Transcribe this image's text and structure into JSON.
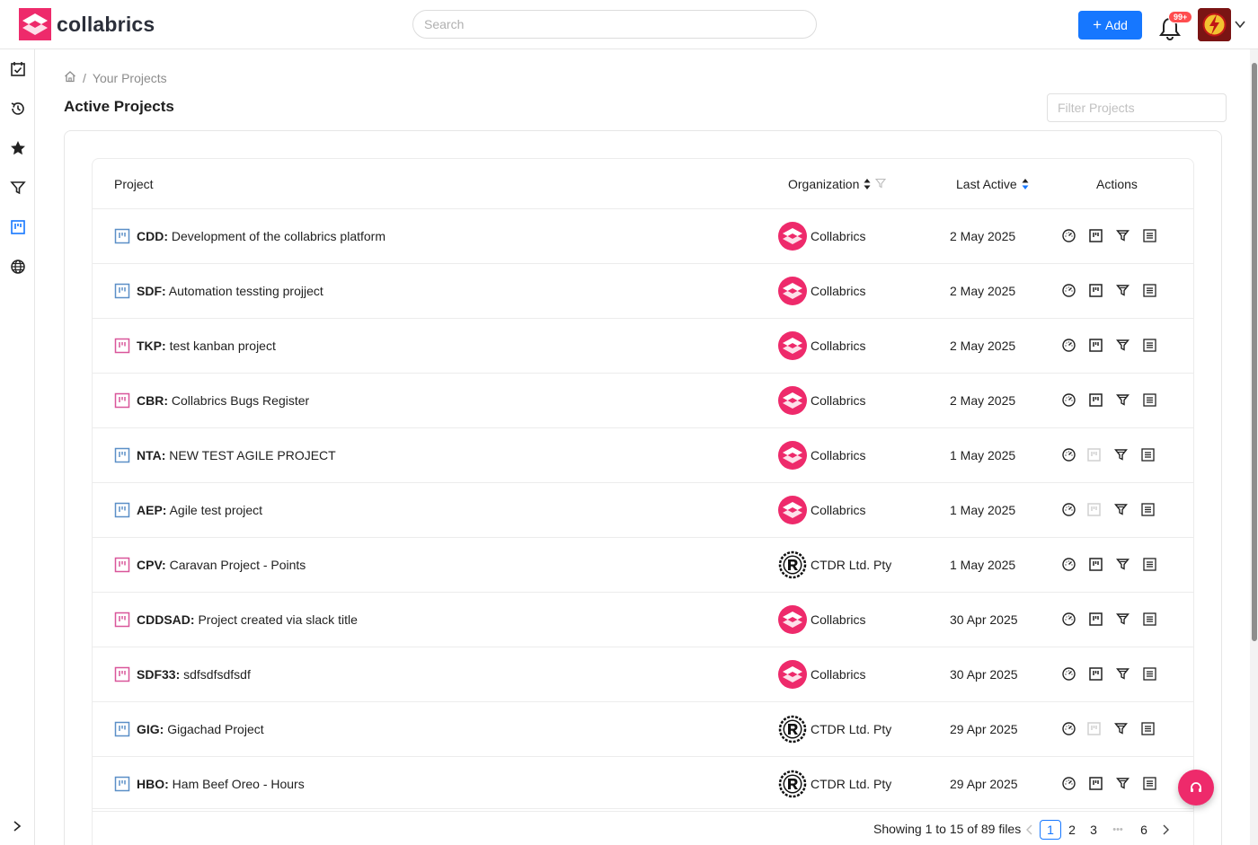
{
  "app": {
    "name": "collabrics"
  },
  "header": {
    "search_placeholder": "Search",
    "add_label": "Add",
    "notification_count": "99+"
  },
  "breadcrumb": {
    "current": "Your Projects",
    "separator": "/"
  },
  "page": {
    "title": "Active Projects",
    "filter_placeholder": "Filter Projects"
  },
  "table": {
    "columns": {
      "project": "Project",
      "organization": "Organization",
      "last_active": "Last Active",
      "actions": "Actions"
    },
    "rows": [
      {
        "code": "CDD:",
        "name": "Development of the collabrics platform",
        "org": "Collabrics",
        "date": "2 May 2025",
        "icon_color": "#5b8fc7",
        "board_enabled": true
      },
      {
        "code": "SDF:",
        "name": "Automation tessting projject",
        "org": "Collabrics",
        "date": "2 May 2025",
        "icon_color": "#5b8fc7",
        "board_enabled": true
      },
      {
        "code": "TKP:",
        "name": "test kanban project",
        "org": "Collabrics",
        "date": "2 May 2025",
        "icon_color": "#d9569a",
        "board_enabled": true
      },
      {
        "code": "CBR:",
        "name": "Collabrics Bugs Register",
        "org": "Collabrics",
        "date": "2 May 2025",
        "icon_color": "#d9569a",
        "board_enabled": true
      },
      {
        "code": "NTA:",
        "name": "NEW TEST AGILE PROJECT",
        "org": "Collabrics",
        "date": "1 May 2025",
        "icon_color": "#5b8fc7",
        "board_enabled": false
      },
      {
        "code": "AEP:",
        "name": "Agile test project",
        "org": "Collabrics",
        "date": "1 May 2025",
        "icon_color": "#5b8fc7",
        "board_enabled": false
      },
      {
        "code": "CPV:",
        "name": "Caravan Project - Points",
        "org": "CTDR Ltd. Pty",
        "date": "1 May 2025",
        "icon_color": "#d9569a",
        "board_enabled": true
      },
      {
        "code": "CDDSAD:",
        "name": "Project created via slack title",
        "org": "Collabrics",
        "date": "30 Apr 2025",
        "icon_color": "#d9569a",
        "board_enabled": true
      },
      {
        "code": "SDF33:",
        "name": "sdfsdfsdfsdf",
        "org": "Collabrics",
        "date": "30 Apr 2025",
        "icon_color": "#d9569a",
        "board_enabled": true
      },
      {
        "code": "GIG:",
        "name": "Gigachad Project",
        "org": "CTDR Ltd. Pty",
        "date": "29 Apr 2025",
        "icon_color": "#5b8fc7",
        "board_enabled": false
      },
      {
        "code": "HBO:",
        "name": "Ham Beef Oreo - Hours",
        "org": "CTDR Ltd. Pty",
        "date": "29 Apr 2025",
        "icon_color": "#5b8fc7",
        "board_enabled": true
      }
    ]
  },
  "pagination": {
    "summary": "Showing 1 to 15 of 89 files",
    "pages": [
      "1",
      "2",
      "3",
      "6"
    ],
    "active_page": "1",
    "ellipsis": "•••"
  },
  "colors": {
    "brand": "#ee2a6b",
    "primary": "#1677ff",
    "notification": "#ff4d4f"
  },
  "icons": {
    "sidebar": [
      "calendar-check-icon",
      "history-icon",
      "star-icon",
      "filter-icon",
      "board-icon",
      "globe-icon"
    ],
    "row_actions": [
      "dashboard-icon",
      "board-icon",
      "filter-icon",
      "list-icon"
    ]
  }
}
